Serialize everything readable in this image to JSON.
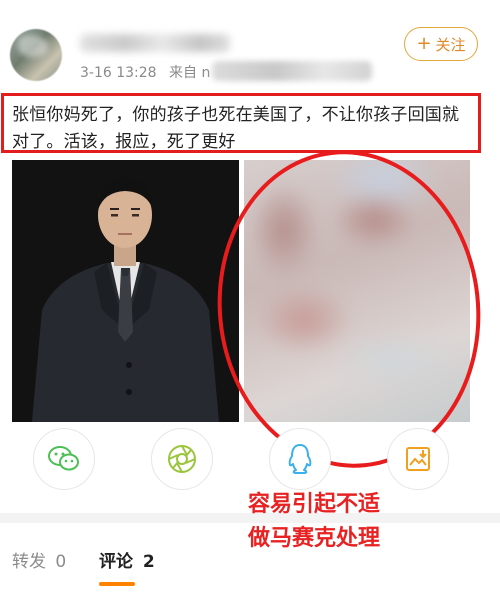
{
  "post": {
    "time": "3-16 13:28",
    "source_prefix": "来自 n",
    "follow_label": "关注",
    "text": "张恒你妈死了，你的孩子也死在美国了，不让你孩子回国就对了。活该，报应，死了更好"
  },
  "notice": {
    "line1": "容易引起不适",
    "line2": "做马赛克处理"
  },
  "share_icons": [
    "wechat-icon",
    "moments-icon",
    "qq-icon",
    "save-image-icon"
  ],
  "tabs": {
    "repost_label": "转发",
    "repost_count": "0",
    "comment_label": "评论",
    "comment_count": "2"
  },
  "colors": {
    "annotation_red": "#e31d1d",
    "follow_orange": "#e0892a",
    "tab_underline": "#ff8200"
  }
}
